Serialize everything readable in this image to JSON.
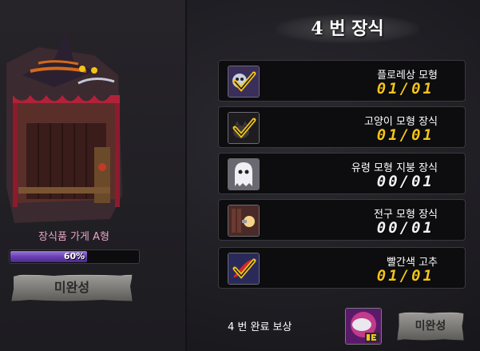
{
  "left": {
    "shop_name": "장식품 가게 A형",
    "progress": {
      "percent": 60,
      "label": "60%"
    },
    "status_button": "미완성"
  },
  "title": "4 번 장식",
  "items": [
    {
      "name": "플로레상 모형",
      "count": "01/01",
      "completed": true,
      "icon": "check-ghost-icon"
    },
    {
      "name": "고양이 모형 장식",
      "count": "01/01",
      "completed": true,
      "icon": "check-cat-icon"
    },
    {
      "name": "유령 모형 지붕 장식",
      "count": "00/01",
      "completed": false,
      "icon": "ghost-icon"
    },
    {
      "name": "전구 모형 장식",
      "count": "00/01",
      "completed": false,
      "icon": "bulb-icon"
    },
    {
      "name": "빨간색 고추",
      "count": "01/01",
      "completed": true,
      "icon": "check-pepper-icon"
    }
  ],
  "reward": {
    "label": "4 번 완료 보상",
    "status_button": "미완성",
    "icon": "reward-item-icon"
  },
  "colors": {
    "completed": "#f2c419",
    "incomplete": "#f2f2f2",
    "progress": "#6a3fb5"
  }
}
